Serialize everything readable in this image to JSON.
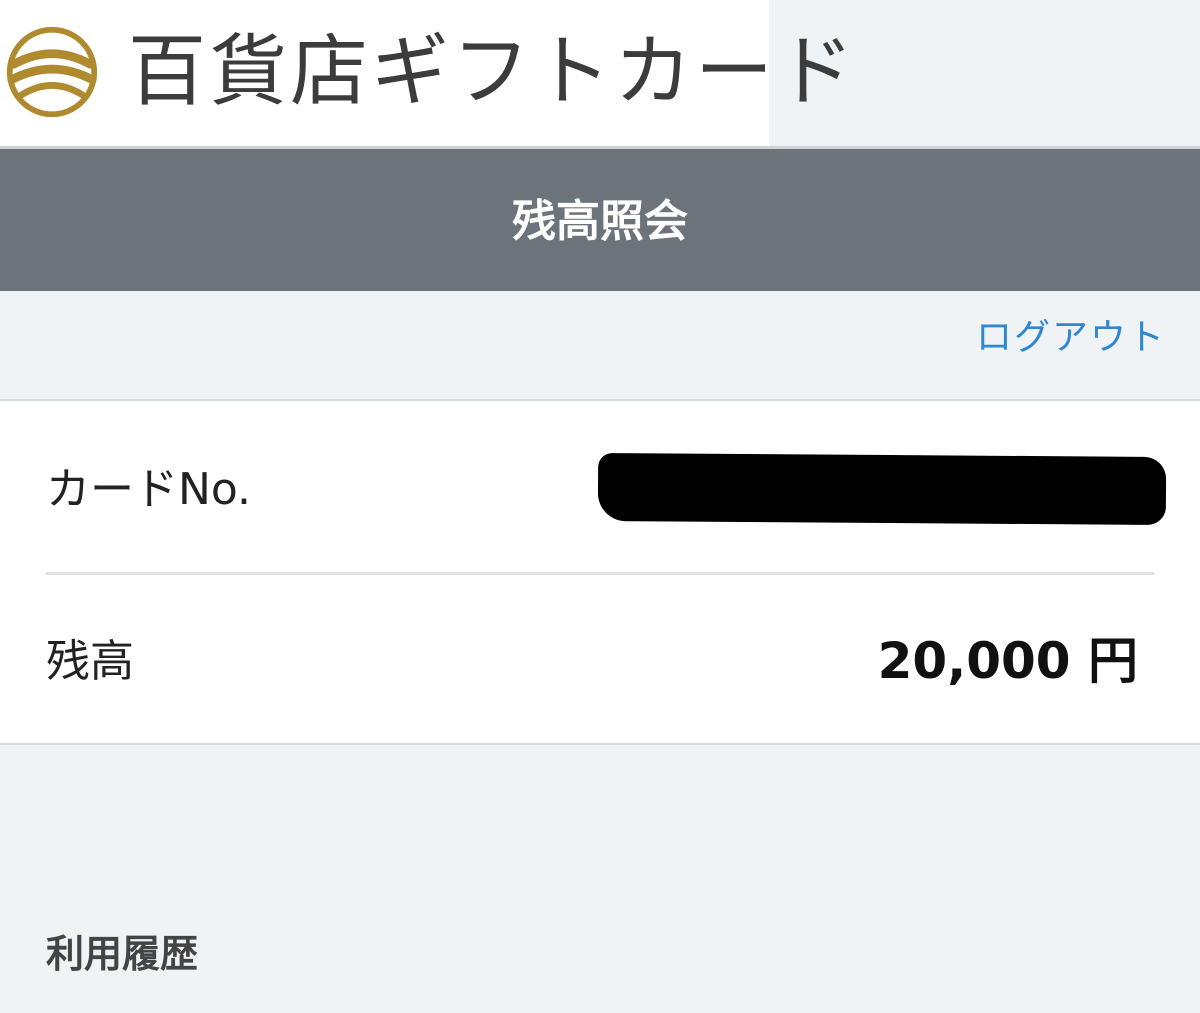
{
  "brand": {
    "name": "百貨店ギフトカード",
    "logo_icon": "globe-logo-icon",
    "logo_color": "#b08a2e"
  },
  "header": {
    "title": "残高照会",
    "background": "#6c737a"
  },
  "actions": {
    "logout_label": "ログアウト",
    "link_color": "#2f86d2"
  },
  "card_info": {
    "card_number_label": "カードNo.",
    "card_number_value": "",
    "balance_label": "残高",
    "balance_value": "20,000 円"
  },
  "history": {
    "title": "利用履歴"
  }
}
